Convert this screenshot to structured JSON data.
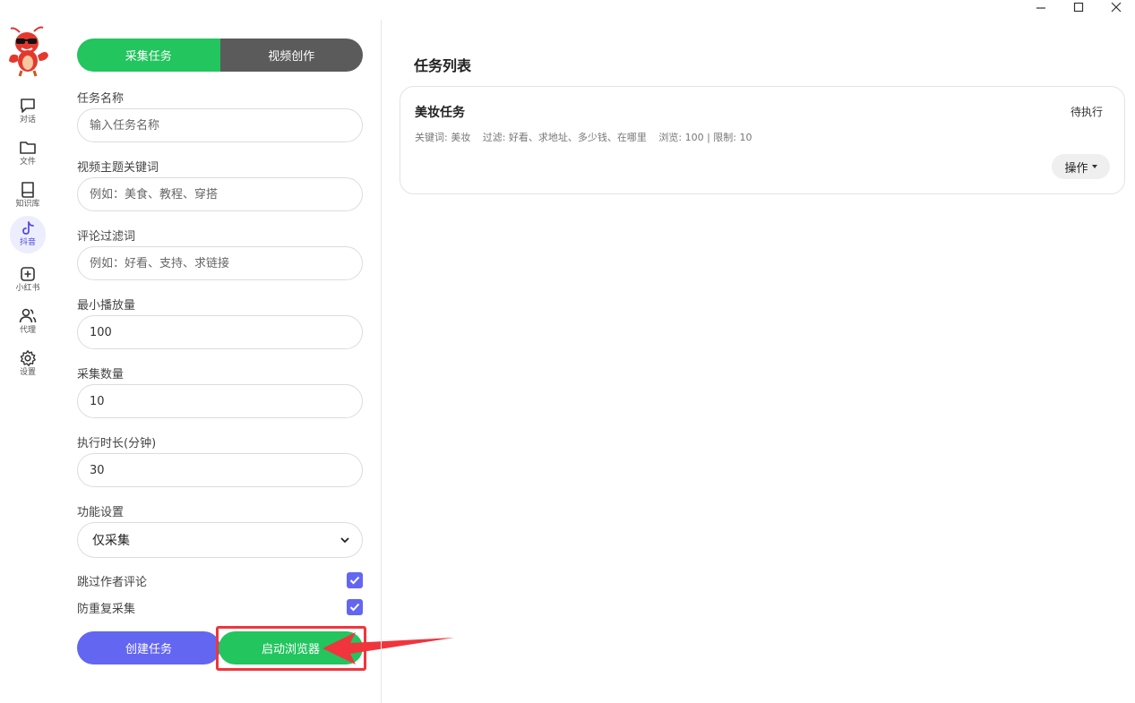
{
  "sidebar": {
    "items": [
      {
        "label": "对话",
        "icon": "chat-icon"
      },
      {
        "label": "文件",
        "icon": "folder-icon"
      },
      {
        "label": "知识库",
        "icon": "book-icon"
      },
      {
        "label": "抖音",
        "icon": "tiktok-icon",
        "active": true
      },
      {
        "label": "小红书",
        "icon": "plus-square-icon"
      },
      {
        "label": "代理",
        "icon": "users-icon"
      },
      {
        "label": "设置",
        "icon": "gear-icon"
      }
    ],
    "active_color": "#eceefd"
  },
  "tabs": {
    "collect": "采集任务",
    "video": "视频创作",
    "active_color": "#22c55e",
    "inactive_color": "#5b5b5b"
  },
  "form": {
    "task_name": {
      "label": "任务名称",
      "placeholder": "输入任务名称",
      "value": ""
    },
    "keywords": {
      "label": "视频主题关键词",
      "placeholder": "例如：美食、教程、穿搭",
      "value": ""
    },
    "filter": {
      "label": "评论过滤词",
      "placeholder": "例如：好看、支持、求链接",
      "value": ""
    },
    "min_plays": {
      "label": "最小播放量",
      "placeholder": "",
      "value": "100"
    },
    "count": {
      "label": "采集数量",
      "placeholder": "",
      "value": "10"
    },
    "duration": {
      "label": "执行时长(分钟)",
      "placeholder": "",
      "value": "30"
    },
    "function": {
      "label": "功能设置",
      "selected": "仅采集"
    },
    "skip_author": {
      "label": "跳过作者评论",
      "checked": true
    },
    "dedupe": {
      "label": "防重复采集",
      "checked": true
    },
    "create_label": "创建任务",
    "launch_label": "启动浏览器",
    "accent": "#6366f1"
  },
  "tasklist": {
    "title": "任务列表",
    "tasks": [
      {
        "name": "美妆任务",
        "status": "待执行",
        "keyword": "关键词: 美妆",
        "filter": "过滤: 好看、求地址、多少钱、在哪里",
        "stats": "浏览: 100 | 限制: 10",
        "ops_label": "操作"
      }
    ]
  },
  "annotation": {
    "color": "#f0353d"
  }
}
